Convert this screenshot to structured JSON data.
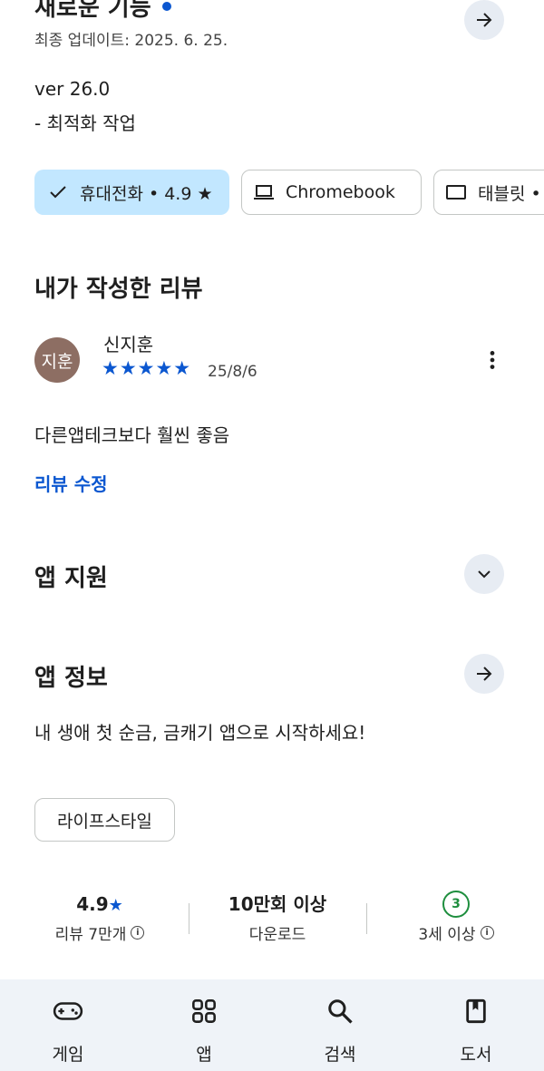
{
  "whats_new": {
    "title": "새로운 기능",
    "updated": "최종 업데이트: 2025. 6. 25.",
    "version": "ver 26.0",
    "note": "- 최적화 작업"
  },
  "device_chips": [
    {
      "label": "휴대전화 • 4.9 ★",
      "icon": "check-icon",
      "selected": true
    },
    {
      "label": "Chromebook",
      "icon": "laptop-icon",
      "selected": false
    },
    {
      "label": "태블릿 •",
      "icon": "tablet-icon",
      "selected": false
    }
  ],
  "my_review": {
    "heading": "내가 작성한 리뷰",
    "avatar_text": "지훈",
    "reviewer": "신지훈",
    "stars": "★★★★★",
    "rating_value": 5,
    "date": "25/8/6",
    "text": "다른앱테크보다 훨씬 좋음",
    "edit_label": "리뷰 수정"
  },
  "app_support": {
    "heading": "앱 지원"
  },
  "app_info": {
    "heading": "앱 정보",
    "description": "내 생애 첫 순금, 금캐기 앱으로 시작하세요!",
    "category_chip": "라이프스타일"
  },
  "stats": {
    "rating": "4.9",
    "rating_star": "★",
    "reviews": "리뷰 7만개",
    "downloads": "10만회 이상",
    "downloads_label": "다운로드",
    "age_badge": "3",
    "age_label": "3세 이상"
  },
  "bottom_nav": [
    {
      "label": "게임",
      "icon": "gamepad-icon"
    },
    {
      "label": "앱",
      "icon": "apps-grid-icon"
    },
    {
      "label": "검색",
      "icon": "search-icon"
    },
    {
      "label": "도서",
      "icon": "book-icon"
    }
  ],
  "colors": {
    "accent": "#0b57d0",
    "chip_selected_bg": "#c2e7ff",
    "avatar_bg": "#8d6e63",
    "age_badge": "#1e8e3e",
    "nav_bg": "#eff3f8"
  }
}
